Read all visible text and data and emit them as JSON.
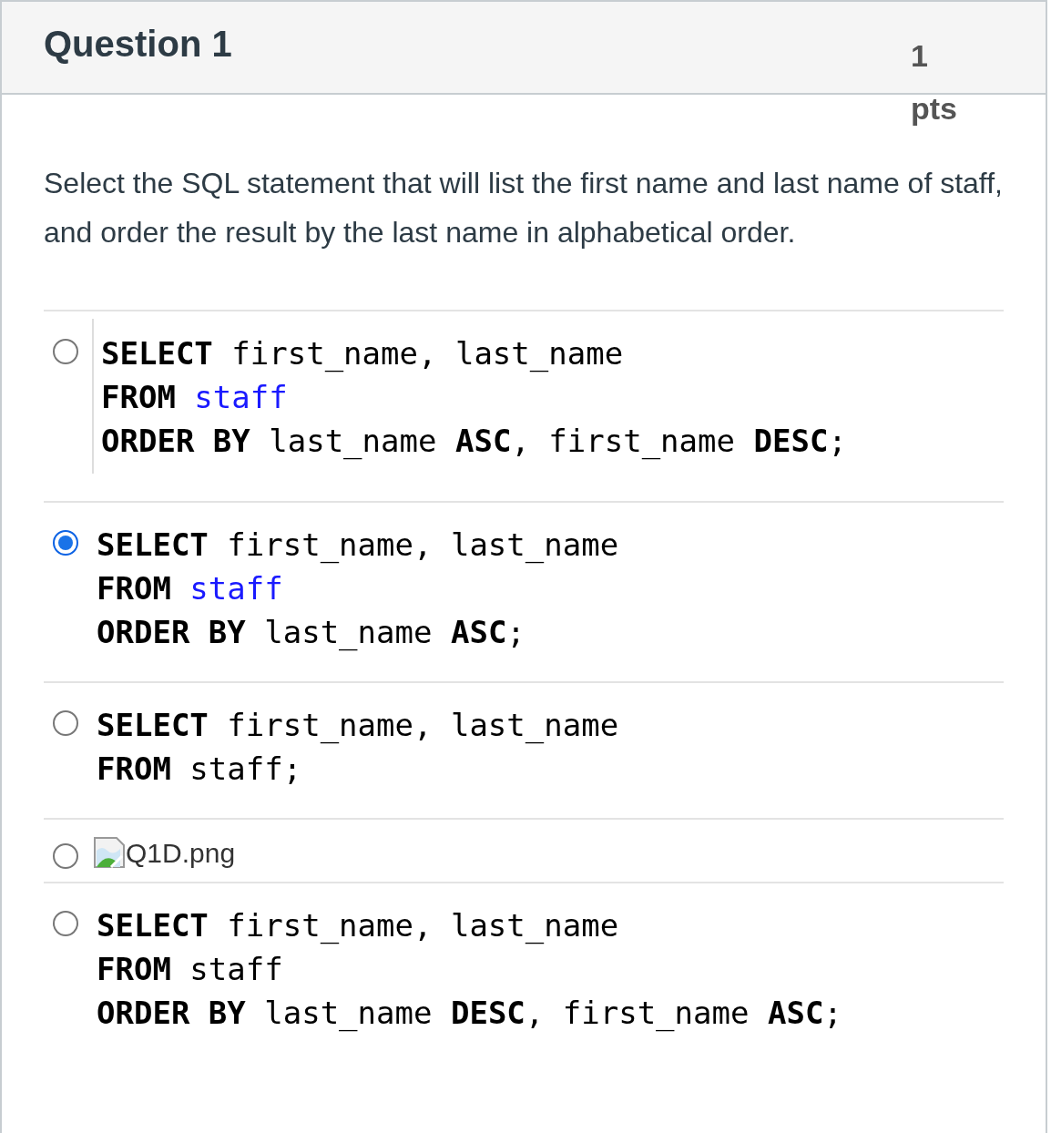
{
  "question": {
    "title": "Question 1",
    "points": "1 pts",
    "prompt": "Select the SQL statement that will list the first name and last name of staff, and order the result by the last name in alphabetical order."
  },
  "options": [
    {
      "kind": "code",
      "selected": false,
      "bordered": true,
      "lines": [
        [
          {
            "text": "SELECT",
            "kind": "keyword"
          },
          {
            "text": " first_name, last_name",
            "kind": "plain"
          }
        ],
        [
          {
            "text": "FROM ",
            "kind": "keyword"
          },
          {
            "text": "staff",
            "kind": "table"
          }
        ],
        [
          {
            "text": "ORDER BY",
            "kind": "keyword"
          },
          {
            "text": " last_name ",
            "kind": "plain"
          },
          {
            "text": "ASC",
            "kind": "keyword"
          },
          {
            "text": ", first_name ",
            "kind": "plain"
          },
          {
            "text": "DESC",
            "kind": "keyword"
          },
          {
            "text": ";",
            "kind": "plain"
          }
        ]
      ]
    },
    {
      "kind": "code",
      "selected": true,
      "bordered": false,
      "lines": [
        [
          {
            "text": "SELECT",
            "kind": "keyword"
          },
          {
            "text": " first_name, last_name",
            "kind": "plain"
          }
        ],
        [
          {
            "text": "FROM ",
            "kind": "keyword"
          },
          {
            "text": "staff",
            "kind": "table"
          }
        ],
        [
          {
            "text": "ORDER BY",
            "kind": "keyword"
          },
          {
            "text": " last_name ",
            "kind": "plain"
          },
          {
            "text": "ASC",
            "kind": "keyword"
          },
          {
            "text": ";",
            "kind": "plain"
          }
        ]
      ]
    },
    {
      "kind": "code",
      "selected": false,
      "bordered": false,
      "lines": [
        [
          {
            "text": "SELECT",
            "kind": "keyword"
          },
          {
            "text": " first_name, last_name",
            "kind": "plain"
          }
        ],
        [
          {
            "text": "FROM",
            "kind": "keyword"
          },
          {
            "text": " staff;",
            "kind": "plain"
          }
        ]
      ]
    },
    {
      "kind": "image",
      "selected": false,
      "alt": "Q1D.png"
    },
    {
      "kind": "code",
      "selected": false,
      "bordered": false,
      "lines": [
        [
          {
            "text": "SELECT",
            "kind": "keyword"
          },
          {
            "text": " first_name, last_name",
            "kind": "plain"
          }
        ],
        [
          {
            "text": "FROM",
            "kind": "keyword"
          },
          {
            "text": " staff",
            "kind": "plain"
          }
        ],
        [
          {
            "text": "ORDER BY",
            "kind": "keyword"
          },
          {
            "text": " last_name ",
            "kind": "plain"
          },
          {
            "text": "DESC",
            "kind": "keyword"
          },
          {
            "text": ", first_name ",
            "kind": "plain"
          },
          {
            "text": "ASC",
            "kind": "keyword"
          },
          {
            "text": ";",
            "kind": "plain"
          }
        ]
      ]
    }
  ]
}
